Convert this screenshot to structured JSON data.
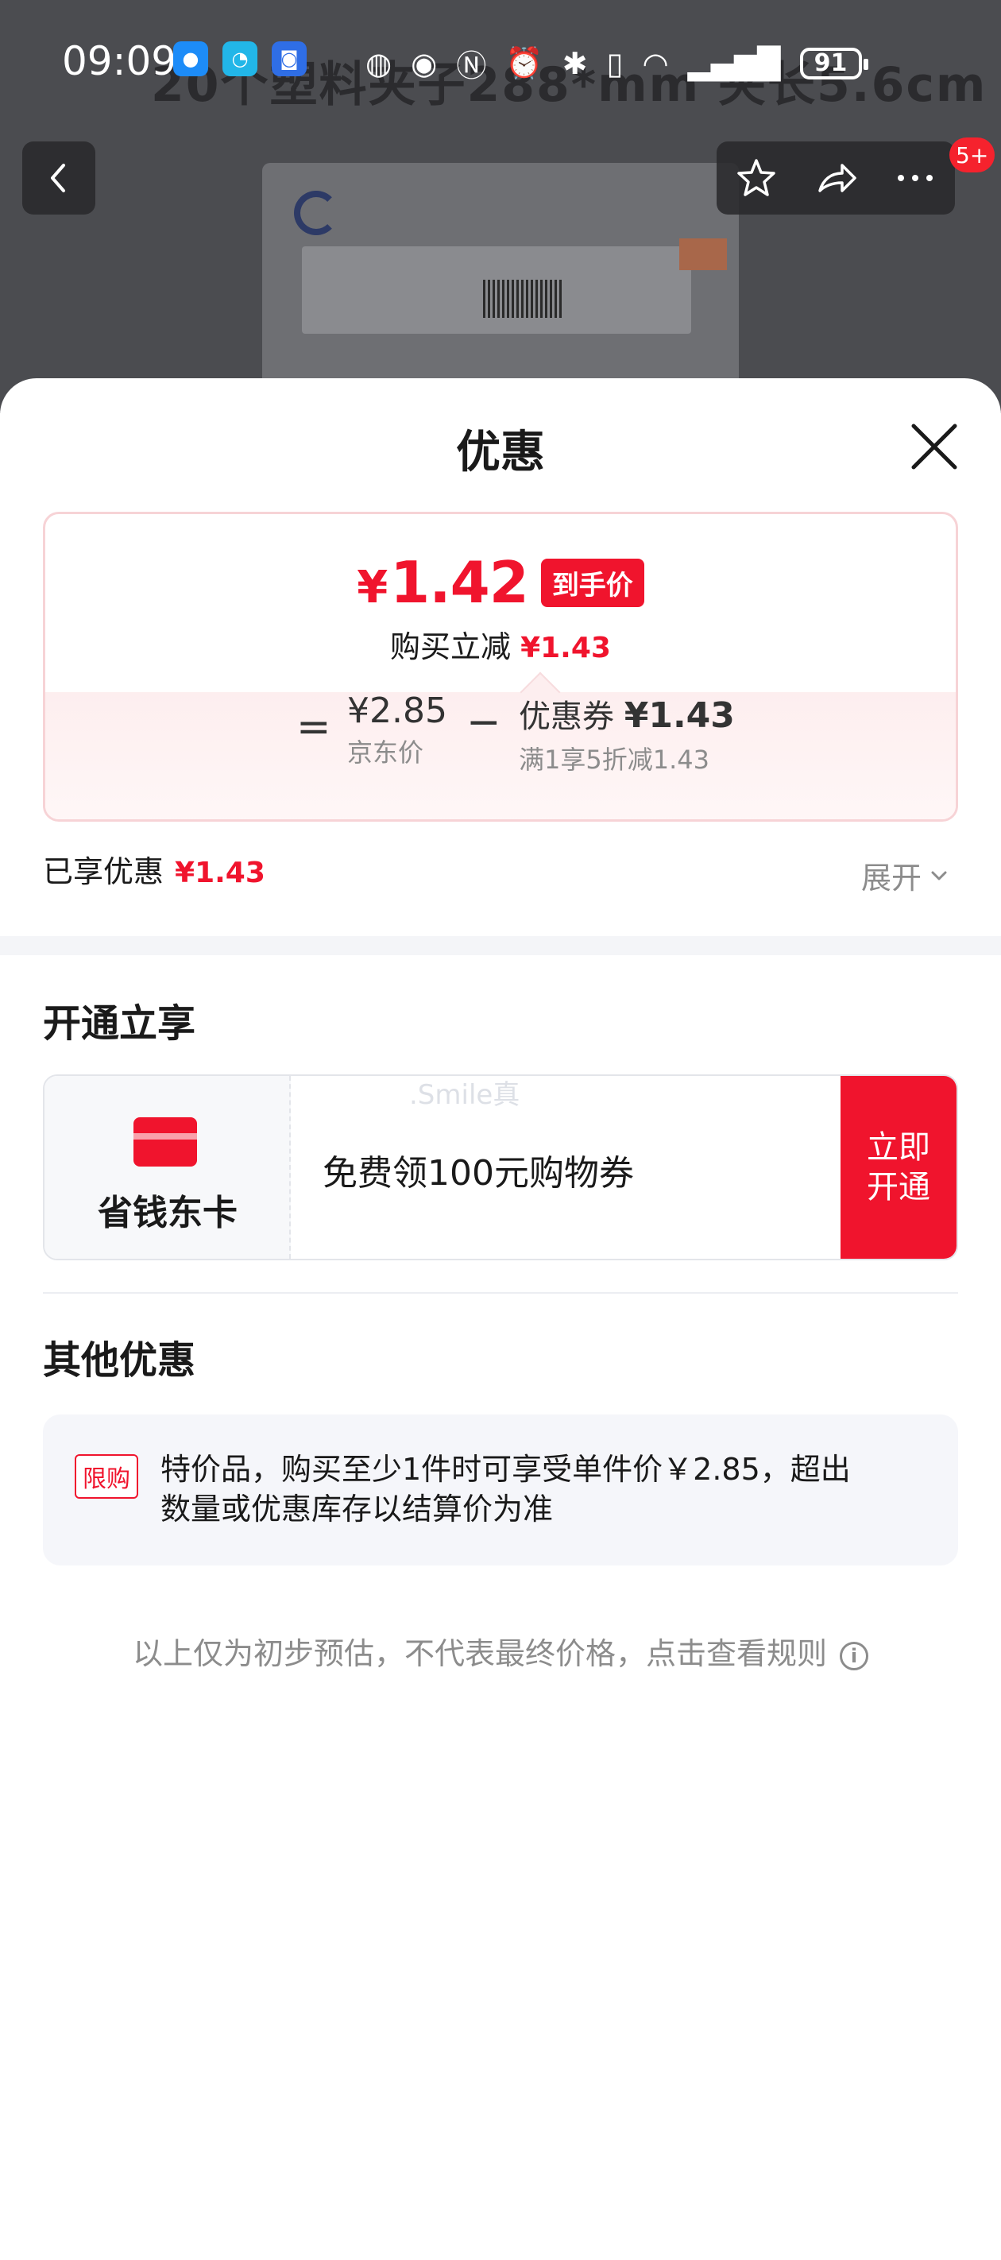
{
  "status_bar": {
    "time": "09:09",
    "battery": "91",
    "app_icons": [
      "qq-robot-icon",
      "browser-icon",
      "files-icon"
    ],
    "system_icons": [
      "hd-icon",
      "eye-icon",
      "nfc-icon",
      "alarm-icon",
      "bluetooth-icon",
      "vibrate-icon",
      "wifi-icon",
      "signal-icon"
    ]
  },
  "background": {
    "product_title_fragment": "20个塑料夹子288*mm 夹长5.6cm",
    "cart_badge": "5+"
  },
  "sheet": {
    "title": "优惠",
    "price_card": {
      "final_price_symbol": "¥",
      "final_price": "1.42",
      "price_tag": "到手价",
      "discount_label": "购买立减",
      "discount_value": "¥1.43",
      "equals": "=",
      "jd_price": "¥2.85",
      "jd_price_label": "京东价",
      "minus": "−",
      "coupon_label": "优惠券",
      "coupon_value": "¥1.43",
      "coupon_rule": "满1享5折减1.43"
    },
    "enjoyed": {
      "label": "已享优惠",
      "value": "¥1.43",
      "expand": "展开"
    },
    "open_section": {
      "title": "开通立享",
      "card_name": "省钱东卡",
      "card_desc": "免费领100元购物券",
      "button_line1": "立即",
      "button_line2": "开通",
      "watermark": ".Smile真"
    },
    "other_section": {
      "title": "其他优惠",
      "tag": "限购",
      "text": "特价品，购买至少1件时可享受单件价￥2.85，超出数量或优惠库存以结算价为准"
    },
    "footnote": "以上仅为初步预估，不代表最终价格，点击查看规则"
  },
  "colors": {
    "accent_red": "#f0142d",
    "card_border": "#f7d3d6",
    "muted_text": "#8c8c8c"
  }
}
